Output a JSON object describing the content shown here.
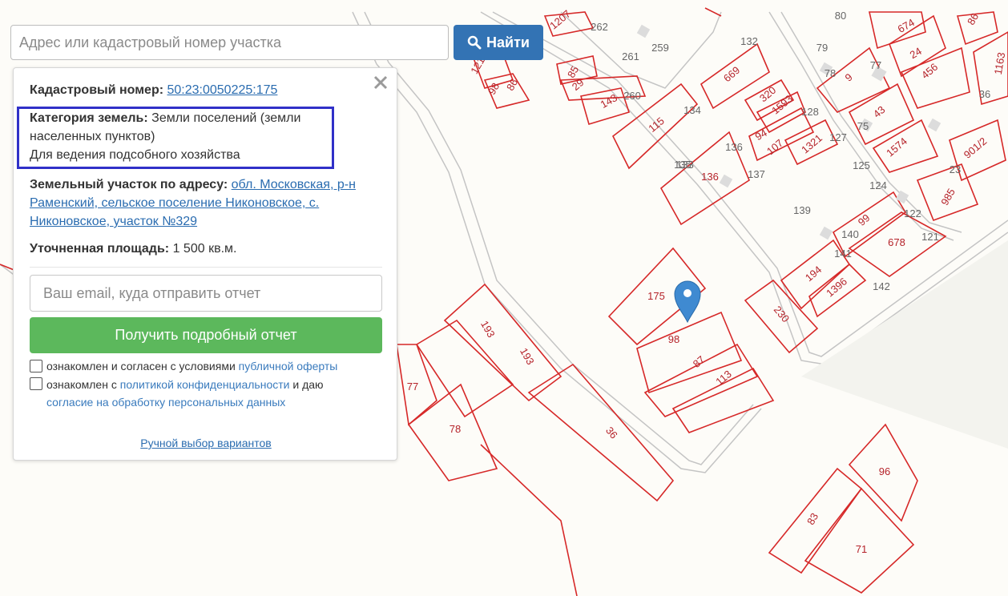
{
  "search": {
    "placeholder": "Адрес или кадастровый номер участка",
    "button_label": "Найти"
  },
  "panel": {
    "cadastral_label": "Кадастровый номер:",
    "cadastral_value": "50:23:0050225:175",
    "category_label": "Категория земель:",
    "category_value_1": "Земли поселений (земли",
    "category_value_2": "населенных пунктов)",
    "category_value_3": "Для ведения подсобного хозяйства",
    "address_label": "Земельный участок по адресу:",
    "address_link_1": "обл. Московская, р-н",
    "address_link_2": "Раменский, сельское поселение Никоновское, с.",
    "address_link_3": "Никоновское, участок №329",
    "area_label": "Уточненная площадь:",
    "area_value": "1 500 кв.м.",
    "email_placeholder": "Ваш email, куда отправить отчет",
    "report_button": "Получить подробный отчет",
    "consent1_text": "ознакомлен и согласен с условиями ",
    "consent1_link": "публичной оферты",
    "consent2_text": "ознакомлен с ",
    "consent2_link": "политикой конфиденциальности",
    "consent2_suffix": " и даю",
    "consent2_link2": "согласие на обработку персональных данных",
    "manual_link": "Ручной выбор вариантов"
  },
  "map": {
    "parcel_labels": [
      "1207",
      "262",
      "259",
      "80",
      "674",
      "86",
      "121",
      "98",
      "86",
      "85",
      "29",
      "261",
      "143",
      "260",
      "132",
      "669",
      "79",
      "77",
      "24",
      "456",
      "1163",
      "115",
      "134",
      "133",
      "320",
      "1593",
      "128",
      "78",
      "9",
      "36",
      "136",
      "94",
      "107",
      "1321",
      "127",
      "75",
      "43",
      "1574",
      "901/2",
      "135",
      "136",
      "137",
      "125",
      "124",
      "139",
      "122",
      "985",
      "99",
      "23",
      "140",
      "678",
      "121",
      "175",
      "141",
      "194",
      "1396",
      "142",
      "98",
      "230",
      "193",
      "193",
      "87",
      "113",
      "77",
      "78",
      "36",
      "96",
      "83",
      "71"
    ],
    "marker_icon": "map-pin-icon"
  },
  "colors": {
    "parcel_stroke": "#d62828",
    "search_button": "#3373b4",
    "report_button": "#5cb85c",
    "highlight_box": "#3030c8"
  }
}
